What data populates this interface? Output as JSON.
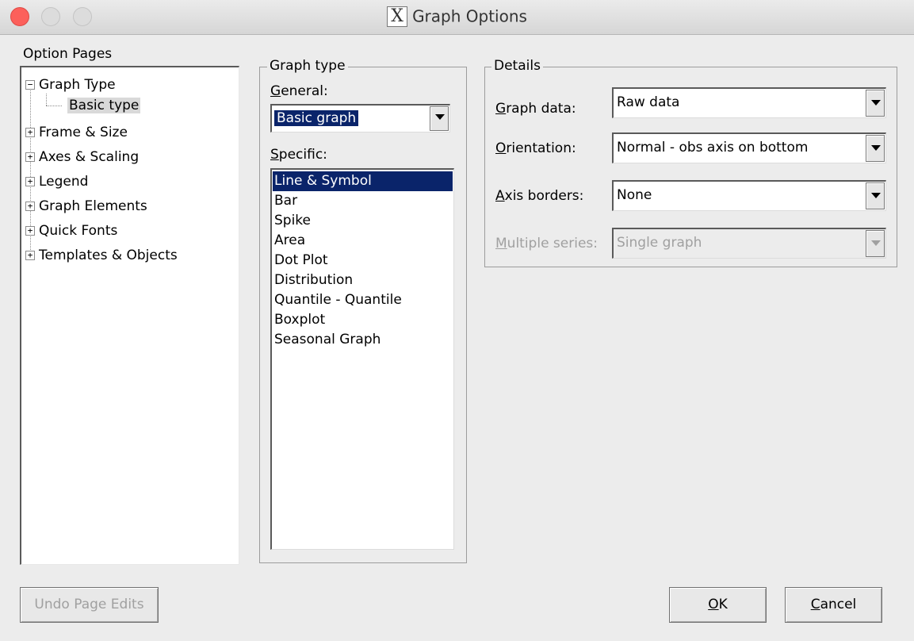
{
  "window": {
    "title": "Graph Options",
    "app_icon_glyph": "X"
  },
  "option_pages": {
    "label": "Option Pages",
    "items": [
      {
        "label": "Graph Type",
        "expander": "−"
      },
      {
        "label": "Basic type"
      },
      {
        "label": "Frame & Size",
        "expander": "+"
      },
      {
        "label": "Axes & Scaling",
        "expander": "+"
      },
      {
        "label": "Legend",
        "expander": "+"
      },
      {
        "label": "Graph Elements",
        "expander": "+"
      },
      {
        "label": "Quick Fonts",
        "expander": "+"
      },
      {
        "label": "Templates & Objects",
        "expander": "+"
      }
    ]
  },
  "graph_type": {
    "group_label": "Graph type",
    "general_label_mnemonic": "G",
    "general_label_rest": "eneral:",
    "general_value": "Basic graph",
    "specific_label_mnemonic": "S",
    "specific_label_rest": "pecific:",
    "specific_items": [
      "Line & Symbol",
      "Bar",
      "Spike",
      "Area",
      "Dot Plot",
      "Distribution",
      "Quantile - Quantile",
      "Boxplot",
      "Seasonal Graph"
    ],
    "specific_selected": "Line & Symbol"
  },
  "details": {
    "group_label": "Details",
    "graph_data": {
      "mnemonic": "G",
      "rest": "raph data:",
      "value": "Raw data"
    },
    "orientation": {
      "mnemonic": "O",
      "rest": "rientation:",
      "value": "Normal - obs axis on bottom"
    },
    "axis_borders": {
      "mnemonic": "A",
      "rest": "xis borders:",
      "value": "None"
    },
    "multiple_series": {
      "mnemonic": "M",
      "rest": "ultiple series:",
      "value": "Single graph",
      "disabled": true
    }
  },
  "buttons": {
    "undo": "Undo Page Edits",
    "ok_mnemonic": "O",
    "ok_rest": "K",
    "cancel_mnemonic": "C",
    "cancel_rest": "ancel"
  },
  "colors": {
    "selection": "#0a246a",
    "close_button": "#fc605b",
    "disabled_text": "#a0a0a0"
  }
}
